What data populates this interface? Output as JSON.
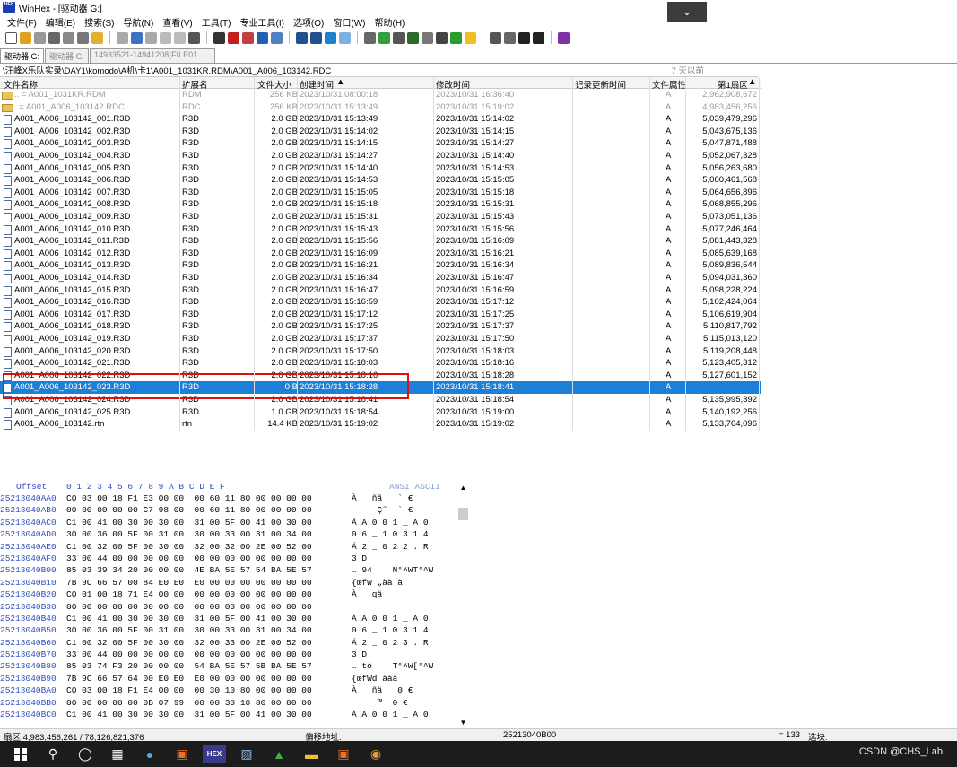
{
  "window": {
    "title": "WinHex - [驱动器 G:]",
    "app_icon_text": "HEX"
  },
  "menu": [
    "文件(F)",
    "编辑(E)",
    "搜索(S)",
    "导航(N)",
    "查看(V)",
    "工具(T)",
    "专业工具(I)",
    "选项(O)",
    "窗口(W)",
    "帮助(H)"
  ],
  "tabs": [
    "驱动器 G:",
    "驱动器 G:",
    "14933521-14941208(FILE01..."
  ],
  "path": "\\汪峰X乐队实录\\DAY1\\komodo\\A机\\卡1\\A001_1031KR.RDM\\A001_A006_103142.RDC",
  "path_ago": "7 天以前",
  "columns": {
    "name": "文件名称",
    "ext": "扩展名",
    "size": "文件大小",
    "ctime": "创建时间",
    "mtime": "修改时间",
    "rtime": "记录更新时间",
    "attr": "文件属性",
    "sector": "第1扇区"
  },
  "files": [
    {
      "name": "..  =   A001_1031KR.RDM",
      "ext": "RDM",
      "size": "256 KB",
      "ctime": "2023/10/31  08:00:18",
      "mtime": "2023/10/31  16:36:40",
      "attr": "A",
      "sector": "2,962,908,672",
      "kind": "folder-dim"
    },
    {
      "name": ".  =   A001_A006_103142.RDC",
      "ext": "RDC",
      "size": "256 KB",
      "ctime": "2023/10/31  15:13:49",
      "mtime": "2023/10/31  15:19:02",
      "attr": "A",
      "sector": "4,983,456,256",
      "kind": "folder-dim"
    },
    {
      "name": "A001_A006_103142_001.R3D",
      "ext": "R3D",
      "size": "2.0 GB",
      "ctime": "2023/10/31  15:13:49",
      "mtime": "2023/10/31  15:14:02",
      "attr": "A",
      "sector": "5,039,479,296",
      "kind": "file"
    },
    {
      "name": "A001_A006_103142_002.R3D",
      "ext": "R3D",
      "size": "2.0 GB",
      "ctime": "2023/10/31  15:14:02",
      "mtime": "2023/10/31  15:14:15",
      "attr": "A",
      "sector": "5,043,675,136",
      "kind": "file"
    },
    {
      "name": "A001_A006_103142_003.R3D",
      "ext": "R3D",
      "size": "2.0 GB",
      "ctime": "2023/10/31  15:14:15",
      "mtime": "2023/10/31  15:14:27",
      "attr": "A",
      "sector": "5,047,871,488",
      "kind": "file"
    },
    {
      "name": "A001_A006_103142_004.R3D",
      "ext": "R3D",
      "size": "2.0 GB",
      "ctime": "2023/10/31  15:14:27",
      "mtime": "2023/10/31  15:14:40",
      "attr": "A",
      "sector": "5,052,067,328",
      "kind": "file"
    },
    {
      "name": "A001_A006_103142_005.R3D",
      "ext": "R3D",
      "size": "2.0 GB",
      "ctime": "2023/10/31  15:14:40",
      "mtime": "2023/10/31  15:14:53",
      "attr": "A",
      "sector": "5,056,263,680",
      "kind": "file"
    },
    {
      "name": "A001_A006_103142_006.R3D",
      "ext": "R3D",
      "size": "2.0 GB",
      "ctime": "2023/10/31  15:14:53",
      "mtime": "2023/10/31  15:15:05",
      "attr": "A",
      "sector": "5,060,461,568",
      "kind": "file"
    },
    {
      "name": "A001_A006_103142_007.R3D",
      "ext": "R3D",
      "size": "2.0 GB",
      "ctime": "2023/10/31  15:15:05",
      "mtime": "2023/10/31  15:15:18",
      "attr": "A",
      "sector": "5,064,656,896",
      "kind": "file"
    },
    {
      "name": "A001_A006_103142_008.R3D",
      "ext": "R3D",
      "size": "2.0 GB",
      "ctime": "2023/10/31  15:15:18",
      "mtime": "2023/10/31  15:15:31",
      "attr": "A",
      "sector": "5,068,855,296",
      "kind": "file"
    },
    {
      "name": "A001_A006_103142_009.R3D",
      "ext": "R3D",
      "size": "2.0 GB",
      "ctime": "2023/10/31  15:15:31",
      "mtime": "2023/10/31  15:15:43",
      "attr": "A",
      "sector": "5,073,051,136",
      "kind": "file"
    },
    {
      "name": "A001_A006_103142_010.R3D",
      "ext": "R3D",
      "size": "2.0 GB",
      "ctime": "2023/10/31  15:15:43",
      "mtime": "2023/10/31  15:15:56",
      "attr": "A",
      "sector": "5,077,246,464",
      "kind": "file"
    },
    {
      "name": "A001_A006_103142_011.R3D",
      "ext": "R3D",
      "size": "2.0 GB",
      "ctime": "2023/10/31  15:15:56",
      "mtime": "2023/10/31  15:16:09",
      "attr": "A",
      "sector": "5,081,443,328",
      "kind": "file"
    },
    {
      "name": "A001_A006_103142_012.R3D",
      "ext": "R3D",
      "size": "2.0 GB",
      "ctime": "2023/10/31  15:16:09",
      "mtime": "2023/10/31  15:16:21",
      "attr": "A",
      "sector": "5,085,639,168",
      "kind": "file"
    },
    {
      "name": "A001_A006_103142_013.R3D",
      "ext": "R3D",
      "size": "2.0 GB",
      "ctime": "2023/10/31  15:16:21",
      "mtime": "2023/10/31  15:16:34",
      "attr": "A",
      "sector": "5,089,836,544",
      "kind": "file"
    },
    {
      "name": "A001_A006_103142_014.R3D",
      "ext": "R3D",
      "size": "2.0 GB",
      "ctime": "2023/10/31  15:16:34",
      "mtime": "2023/10/31  15:16:47",
      "attr": "A",
      "sector": "5,094,031,360",
      "kind": "file"
    },
    {
      "name": "A001_A006_103142_015.R3D",
      "ext": "R3D",
      "size": "2.0 GB",
      "ctime": "2023/10/31  15:16:47",
      "mtime": "2023/10/31  15:16:59",
      "attr": "A",
      "sector": "5,098,228,224",
      "kind": "file"
    },
    {
      "name": "A001_A006_103142_016.R3D",
      "ext": "R3D",
      "size": "2.0 GB",
      "ctime": "2023/10/31  15:16:59",
      "mtime": "2023/10/31  15:17:12",
      "attr": "A",
      "sector": "5,102,424,064",
      "kind": "file"
    },
    {
      "name": "A001_A006_103142_017.R3D",
      "ext": "R3D",
      "size": "2.0 GB",
      "ctime": "2023/10/31  15:17:12",
      "mtime": "2023/10/31  15:17:25",
      "attr": "A",
      "sector": "5,106,619,904",
      "kind": "file"
    },
    {
      "name": "A001_A006_103142_018.R3D",
      "ext": "R3D",
      "size": "2.0 GB",
      "ctime": "2023/10/31  15:17:25",
      "mtime": "2023/10/31  15:17:37",
      "attr": "A",
      "sector": "5,110,817,792",
      "kind": "file"
    },
    {
      "name": "A001_A006_103142_019.R3D",
      "ext": "R3D",
      "size": "2.0 GB",
      "ctime": "2023/10/31  15:17:37",
      "mtime": "2023/10/31  15:17:50",
      "attr": "A",
      "sector": "5,115,013,120",
      "kind": "file"
    },
    {
      "name": "A001_A006_103142_020.R3D",
      "ext": "R3D",
      "size": "2.0 GB",
      "ctime": "2023/10/31  15:17:50",
      "mtime": "2023/10/31  15:18:03",
      "attr": "A",
      "sector": "5,119,208,448",
      "kind": "file"
    },
    {
      "name": "A001_A006_103142_021.R3D",
      "ext": "R3D",
      "size": "2.0 GB",
      "ctime": "2023/10/31  15:18:03",
      "mtime": "2023/10/31  15:18:16",
      "attr": "A",
      "sector": "5,123,405,312",
      "kind": "file"
    },
    {
      "name": "A001_A006_103142_022.R3D",
      "ext": "R3D",
      "size": "2.0 GB",
      "ctime": "2023/10/31  15:18:16",
      "mtime": "2023/10/31  15:18:28",
      "attr": "A",
      "sector": "5,127,601,152",
      "kind": "file-strike"
    },
    {
      "name": "A001_A006_103142_023.R3D",
      "ext": "R3D",
      "size": "0 B",
      "ctime": "2023/10/31  15:18:28",
      "mtime": "2023/10/31  15:18:41",
      "attr": "A",
      "sector": "",
      "kind": "selected"
    },
    {
      "name": "A001_A006_103142_024.R3D",
      "ext": "R3D",
      "size": "2.0 GB",
      "ctime": "2023/10/31  15:18:41",
      "mtime": "2023/10/31  15:18:54",
      "attr": "A",
      "sector": "5,135,995,392",
      "kind": "file-strike"
    },
    {
      "name": "A001_A006_103142_025.R3D",
      "ext": "R3D",
      "size": "1.0 GB",
      "ctime": "2023/10/31  15:18:54",
      "mtime": "2023/10/31  15:19:00",
      "attr": "A",
      "sector": "5,140,192,256",
      "kind": "file"
    },
    {
      "name": "A001_A006_103142.rtn",
      "ext": "rtn",
      "size": "14.4 KB",
      "ctime": "2023/10/31  15:19:02",
      "mtime": "2023/10/31  15:19:02",
      "attr": "A",
      "sector": "5,133,764,096",
      "kind": "file"
    }
  ],
  "hex": {
    "header_offset": "Offset",
    "header_bytes": "0  1  2  3  4  5  6  7   8  9  A  B  C  D  E  F",
    "header_ansi": "ANSI ASCII",
    "rows": [
      {
        "off": "25213040AA0",
        "bytes": "C0 03 00 18 F1 E3 00 00  00 60 11 80 00 00 00 00",
        "ansi": "À   ñã   ` €"
      },
      {
        "off": "25213040AB0",
        "bytes": "00 00 00 00 00 C7 98 00  00 60 11 80 00 00 00 00",
        "ansi": "     Ç˜  ` €"
      },
      {
        "off": "25213040AC0",
        "bytes": "C1 00 41 00 30 00 30 00  31 00 5F 00 41 00 30 00",
        "ansi": "Á A 0 0 1 _ A 0"
      },
      {
        "off": "25213040AD0",
        "bytes": "30 00 36 00 5F 00 31 00  30 00 33 00 31 00 34 00",
        "ansi": "0 6 _ 1 0 3 1 4"
      },
      {
        "off": "25213040AE0",
        "bytes": "C1 00 32 00 5F 00 30 00  32 00 32 00 2E 00 52 00",
        "ansi": "Á 2 _ 0 2 2 . R"
      },
      {
        "off": "25213040AF0",
        "bytes": "33 00 44 00 00 00 00 00  00 00 00 00 00 00 00 00",
        "ansi": "3 D"
      },
      {
        "off": "25213040B00",
        "bytes": "85 03 39 34 20 00 00 00  4E BA 5E 57 54 BA 5E 57",
        "ansi": "… 94    N°^WT°^W"
      },
      {
        "off": "25213040B10",
        "bytes": "7B 9C 66 57 00 84 E0 E0  E0 00 00 00 00 00 00 00",
        "ansi": "{œfW „àà à"
      },
      {
        "off": "25213040B20",
        "bytes": "C0 01 00 18 71 E4 00 00  00 00 00 00 00 00 00 00",
        "ansi": "À   qä"
      },
      {
        "off": "25213040B30",
        "bytes": "00 00 00 00 00 00 00 00  00 00 00 00 00 00 00 00",
        "ansi": ""
      },
      {
        "off": "25213040B40",
        "bytes": "C1 00 41 00 30 00 30 00  31 00 5F 00 41 00 30 00",
        "ansi": "Á A 0 0 1 _ A 0"
      },
      {
        "off": "25213040B50",
        "bytes": "30 00 36 00 5F 00 31 00  30 00 33 00 31 00 34 00",
        "ansi": "0 6 _ 1 0 3 1 4"
      },
      {
        "off": "25213040B60",
        "bytes": "C1 00 32 00 5F 00 30 00  32 00 33 00 2E 00 52 00",
        "ansi": "Á 2 _ 0 2 3 . R"
      },
      {
        "off": "25213040B70",
        "bytes": "33 00 44 00 00 00 00 00  00 00 00 00 00 00 00 00",
        "ansi": "3 D"
      },
      {
        "off": "25213040B80",
        "bytes": "85 03 74 F3 20 00 00 00  54 BA 5E 57 5B BA 5E 57",
        "ansi": "… tó    T°^W[°^W"
      },
      {
        "off": "25213040B90",
        "bytes": "7B 9C 66 57 64 00 E0 E0  E0 00 00 00 00 00 00 00",
        "ansi": "{œfWd ààà"
      },
      {
        "off": "25213040BA0",
        "bytes": "C0 03 00 18 F1 E4 00 00  00 30 10 80 00 00 00 00",
        "ansi": "À   ñä   0 €"
      },
      {
        "off": "25213040BB0",
        "bytes": "00 00 00 00 00 0B 07 99  00 00 30 10 80 00 00 00",
        "ansi": "     ™  0 €"
      },
      {
        "off": "25213040BC0",
        "bytes": "C1 00 41 00 30 00 30 00  31 00 5F 00 41 00 30 00",
        "ansi": "Á A 0 0 1 _ A 0"
      }
    ]
  },
  "status": {
    "sector": "扇区 4,983,456,261 / 78,126,821,376",
    "offset_label": "偏移地址:",
    "offset_value": "25213040B00",
    "eq": "= 133",
    "select_label": "选块:"
  },
  "watermark": "CSDN @CHS_Lab",
  "colors": {
    "selection": "#1e7fd6",
    "highlight_box": "#e01010",
    "offset_blue": "#3050c0"
  }
}
